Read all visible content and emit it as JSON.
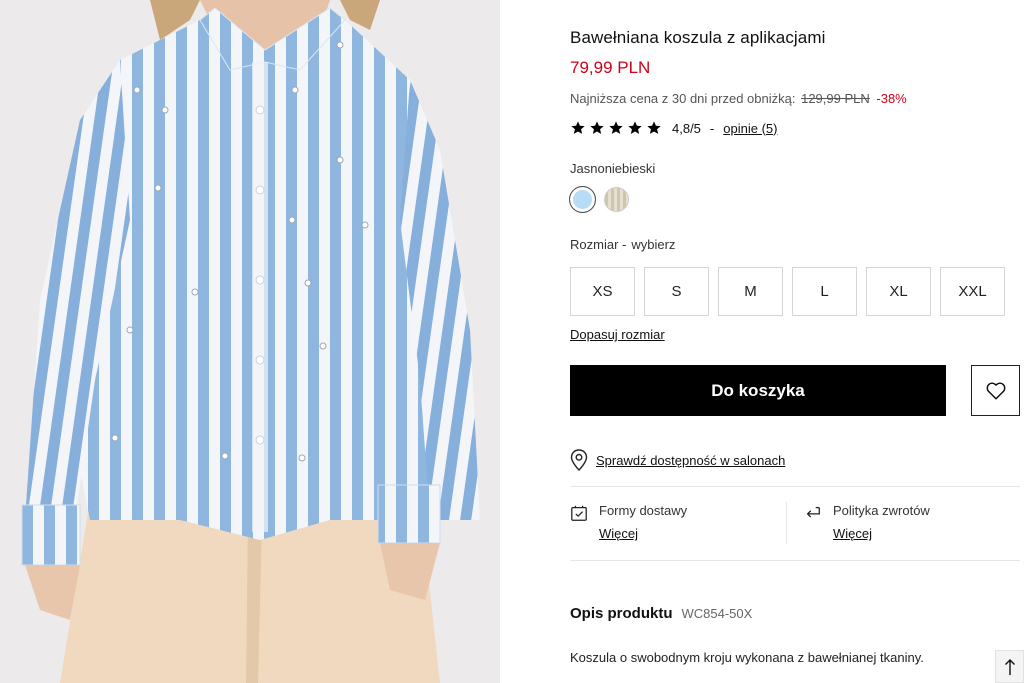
{
  "product": {
    "title": "Bawełniana koszula z aplikacjami",
    "price": "79,99 PLN",
    "lowest_price_label": "Najniższa cena z 30 dni przed obniżką:",
    "old_price": "129,99 PLN",
    "discount": "-38%"
  },
  "rating": {
    "stars": 5,
    "score": "4,8/5",
    "separator": "-",
    "reviews_link": "opinie (5)"
  },
  "color": {
    "label": "Jasnoniebieski",
    "swatches": [
      {
        "name": "light-blue",
        "hex": "#b8dcf5",
        "selected": true
      },
      {
        "name": "beige-striped",
        "hex": "#d8d0b8",
        "selected": false
      }
    ]
  },
  "size": {
    "label": "Rozmiar -",
    "placeholder": "wybierz",
    "options": [
      "XS",
      "S",
      "M",
      "L",
      "XL",
      "XXL"
    ],
    "fit_link": "Dopasuj rozmiar"
  },
  "actions": {
    "add_to_cart": "Do koszyka",
    "wishlist_icon": "heart-icon"
  },
  "availability": {
    "link": "Sprawdź dostępność w salonach",
    "icon": "map-pin-icon"
  },
  "delivery": {
    "label": "Formy dostawy",
    "more": "Więcej",
    "icon": "delivery-box-icon"
  },
  "returns": {
    "label": "Polityka zwrotów",
    "more": "Więcej",
    "icon": "return-arrow-icon"
  },
  "description": {
    "heading": "Opis produktu",
    "code": "WC854-50X",
    "text": "Koszula o swobodnym kroju wykonana z bawełnianej tkaniny."
  },
  "colors": {
    "accent_red": "#d0021b",
    "button_black": "#000000"
  }
}
